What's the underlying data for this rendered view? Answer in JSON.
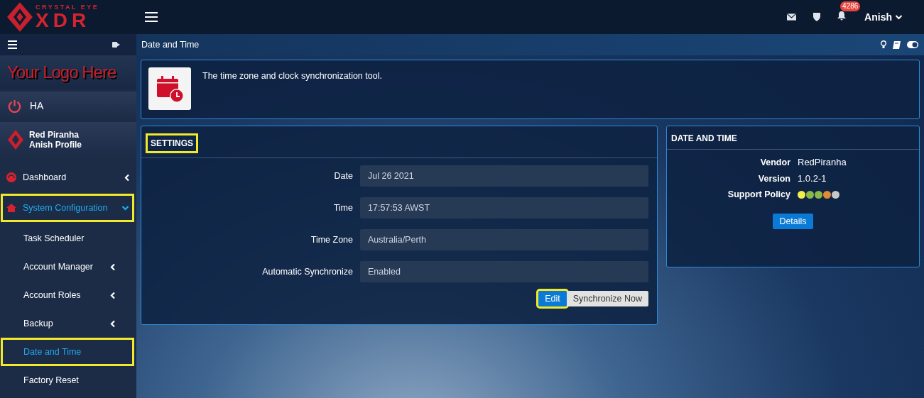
{
  "brand": {
    "tagline": "CRYSTAL EYE",
    "name": "XDR"
  },
  "topbar": {
    "notification_count": "4286",
    "user": "Anish"
  },
  "sidebar": {
    "logo_text": "Your Logo Here",
    "ha": "HA",
    "profile": {
      "name": "Red Piranha",
      "subtitle": "Anish Profile"
    },
    "items": [
      {
        "label": "Dashboard",
        "kind": "section",
        "expanded": false,
        "selected": false,
        "highlighted": false
      },
      {
        "label": "System Configuration",
        "kind": "section",
        "expanded": true,
        "selected": true,
        "highlighted": true
      },
      {
        "label": "Task Scheduler",
        "kind": "sub",
        "has_children": false,
        "selected": false,
        "highlighted": false
      },
      {
        "label": "Account Manager",
        "kind": "sub",
        "has_children": true,
        "selected": false,
        "highlighted": false
      },
      {
        "label": "Account Roles",
        "kind": "sub",
        "has_children": true,
        "selected": false,
        "highlighted": false
      },
      {
        "label": "Backup",
        "kind": "sub",
        "has_children": true,
        "selected": false,
        "highlighted": false
      },
      {
        "label": "Date and Time",
        "kind": "sub",
        "has_children": false,
        "selected": true,
        "highlighted": true
      },
      {
        "label": "Factory Reset",
        "kind": "sub",
        "has_children": false,
        "selected": false,
        "highlighted": false
      }
    ]
  },
  "page": {
    "title": "Date and Time",
    "description": "The time zone and clock synchronization tool."
  },
  "settings": {
    "title": "SETTINGS",
    "title_highlighted": true,
    "fields": [
      {
        "label": "Date",
        "value": "Jul 26 2021"
      },
      {
        "label": "Time",
        "value": "17:57:53 AWST"
      },
      {
        "label": "Time Zone",
        "value": "Australia/Perth"
      },
      {
        "label": "Automatic Synchronize",
        "value": "Enabled"
      }
    ],
    "buttons": [
      {
        "label": "Edit",
        "kind": "primary",
        "highlighted": true
      },
      {
        "label": "Synchronize Now",
        "kind": "secondary",
        "highlighted": false
      }
    ]
  },
  "info": {
    "title": "DATE AND TIME",
    "rows": [
      {
        "label": "Vendor",
        "value": "RedPiranha"
      },
      {
        "label": "Version",
        "value": "1.0.2-1"
      }
    ],
    "support_policy": {
      "label": "Support Policy",
      "dots": [
        {
          "color": "#f2ee4a"
        },
        {
          "color": "#8cb84a"
        },
        {
          "color": "#8cb84a"
        },
        {
          "color": "#e08a32"
        },
        {
          "color": "#c8c8c8"
        }
      ]
    },
    "button": "Details"
  }
}
